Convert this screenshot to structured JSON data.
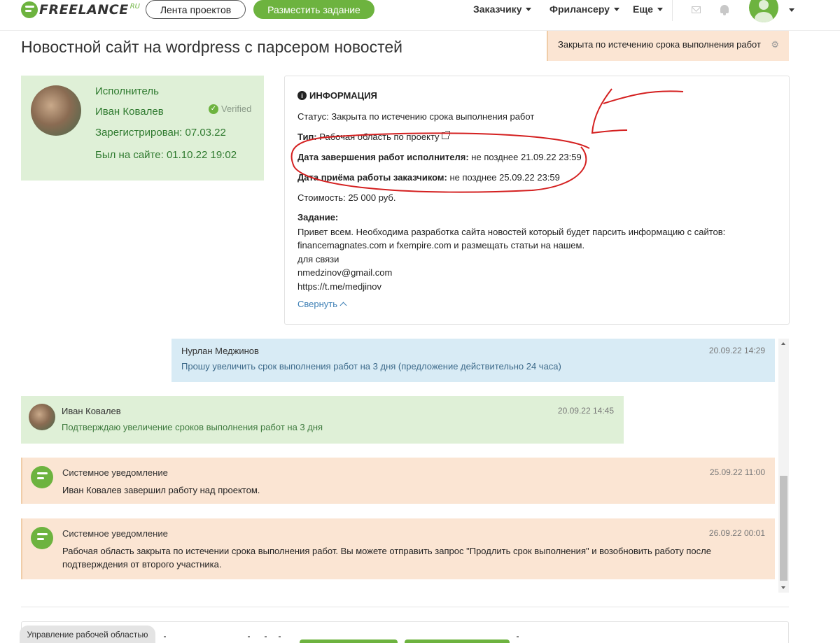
{
  "header": {
    "logo_text": "FREELANCE",
    "logo_suffix": "RU",
    "feed_button": "Лента проектов",
    "post_button": "Разместить задание",
    "nav": [
      "Заказчику",
      "Фрилансеру",
      "Еще"
    ],
    "icons": [
      "mail-icon",
      "bell-icon",
      "user-avatar"
    ]
  },
  "page": {
    "title": "Новостной сайт на wordpress с парсером новостей",
    "status_banner": "Закрыта по истечению срока выполнения работ"
  },
  "executor": {
    "role": "Исполнитель",
    "name": "Иван Ковалев",
    "verified": "Verified",
    "registered": "Зарегистрирован: 07.03.22",
    "last_seen": "Был на сайте: 01.10.22 19:02"
  },
  "info": {
    "heading": "ИНФОРМАЦИЯ",
    "status_label": "Статус:",
    "status_value": " Закрыта по истечению срока выполнения работ",
    "type_label": "Тип:",
    "type_value": " Рабочая область по проекту",
    "deadline_label": "Дата завершения работ исполнителя:",
    "deadline_value": " не позднее 21.09.22 23:59",
    "accept_label": "Дата приёма работы заказчиком:",
    "accept_value": " не позднее 25.09.22 23:59",
    "cost_label": "Стоимость:",
    "cost_value": " 25 000 руб.",
    "task_label": "Задание:",
    "task_text": "Привет всем. Необходима разработка сайта новостей который будет парсить информацию с сайтов:\nfinancemagnates.com и fxempire.com и размещать статьи на нашем.\nдля связи\nnmedzinov@gmail.com\nhttps://t.me/medjinov",
    "collapse": "Свернуть"
  },
  "messages": [
    {
      "author": "Нурлан Меджинов",
      "time": "20.09.22 14:29",
      "text": "Прошу увеличить срок выполнения работ на 3 дня (предложение действительно 24 часа)"
    },
    {
      "author": "Иван Ковалев",
      "time": "20.09.22 14:45",
      "text": "Подтверждаю увеличение сроков выполнения работ на 3 дня"
    },
    {
      "author": "Системное уведомление",
      "time": "25.09.22 11:00",
      "text": "Иван Ковалев завершил работу над проектом."
    },
    {
      "author": "Системное уведомление",
      "time": "26.09.22 00:01",
      "text": "Рабочая область закрыта по истечении срока выполнения работ. Вы можете отправить запрос \"Продлить срок выполнения\" и возобновить работу после подтверждения от второго участника."
    }
  ],
  "footer": {
    "workspace_tab": "Управление рабочей областью"
  },
  "colors": {
    "brand_green": "#6db33f",
    "executor_bg": "#dff0d7",
    "client_msg_bg": "#d8ebf5",
    "system_msg_bg": "#fbe5d3",
    "annotation_red": "#d42020"
  }
}
